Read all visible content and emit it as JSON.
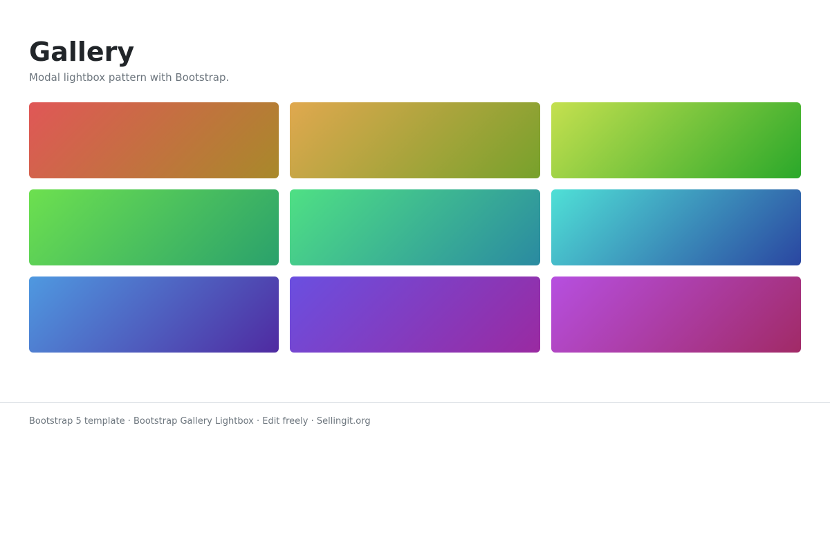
{
  "header": {
    "title": "Gallery",
    "subtitle": "Modal lightbox pattern with Bootstrap."
  },
  "gallery": {
    "items": [
      {
        "from": "#e05757",
        "to": "#a8892a"
      },
      {
        "from": "#e0a84f",
        "to": "#77a12b"
      },
      {
        "from": "#c5e04f",
        "to": "#2aa82a"
      },
      {
        "from": "#6de04f",
        "to": "#2aa16c"
      },
      {
        "from": "#4fe084",
        "to": "#2a8aa1"
      },
      {
        "from": "#4fe0d6",
        "to": "#2a46a1"
      },
      {
        "from": "#4f99e0",
        "to": "#4f2aa1"
      },
      {
        "from": "#6a4fe0",
        "to": "#9a2aa1"
      },
      {
        "from": "#b64fe0",
        "to": "#a12a66"
      }
    ]
  },
  "footer": {
    "text": "Bootstrap 5 template · Bootstrap Gallery Lightbox · Edit freely · Sellingit.org"
  }
}
